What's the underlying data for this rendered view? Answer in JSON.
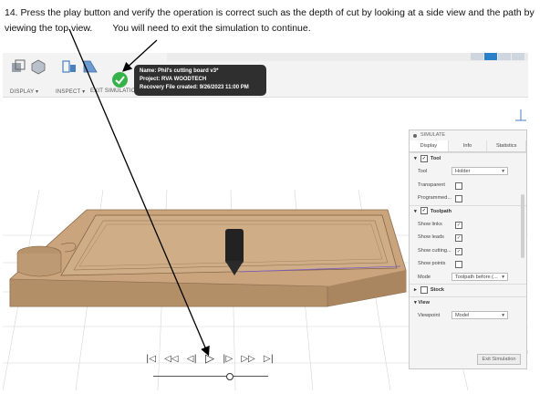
{
  "instruction": {
    "part1": "14. Press the play button and verify the operation is correct such as the depth of cut by looking at a side view and the path by viewing the top view.",
    "part2": "You will need to exit the simulation to continue."
  },
  "toolbar": {
    "display_label": "DISPLAY ▾",
    "inspect_label": "INSPECT ▾",
    "exit_label": "EXIT SIMULATION"
  },
  "tooltip": {
    "name": "Name: Phil's cutting board v3*",
    "project": "Project: RVA WOODTECH",
    "recovery": "Recovery File created: 9/26/2023 11:00 PM"
  },
  "panel": {
    "title": "SIMULATE",
    "tabs": [
      "Display",
      "Info",
      "Statistics"
    ],
    "tool_section": "Tool",
    "tool_rows": {
      "tool_label": "Tool",
      "tool_value": "Holder",
      "transparent_label": "Transparent",
      "programmed_label": "Programmed..."
    },
    "toolpath_section": "Toolpath",
    "toolpath_rows": {
      "show_links": "Show links",
      "show_leads": "Show leads",
      "show_cutting": "Show cutting...",
      "show_points": "Show points",
      "mode_label": "Mode",
      "mode_value": "Toolpath before (..."
    },
    "stock_section": "Stock",
    "view_section": "View",
    "viewpoint_label": "Viewpoint",
    "viewpoint_value": "Model",
    "exit_button": "Exit Simulation"
  },
  "playback": {
    "icons": [
      "skip-start-icon",
      "step-back-all-icon",
      "step-back-icon",
      "play-icon",
      "step-forward-icon",
      "step-forward-all-icon",
      "skip-end-icon"
    ],
    "glyphs": [
      "|◁",
      "◁◁",
      "◁|",
      "▷",
      "|▷",
      "▷▷",
      "▷|"
    ]
  },
  "colors": {
    "wood": "#c8a27a",
    "wood_dark": "#a37e58",
    "check_green": "#35b24a",
    "tooltip_bg": "#2f2f2f"
  }
}
